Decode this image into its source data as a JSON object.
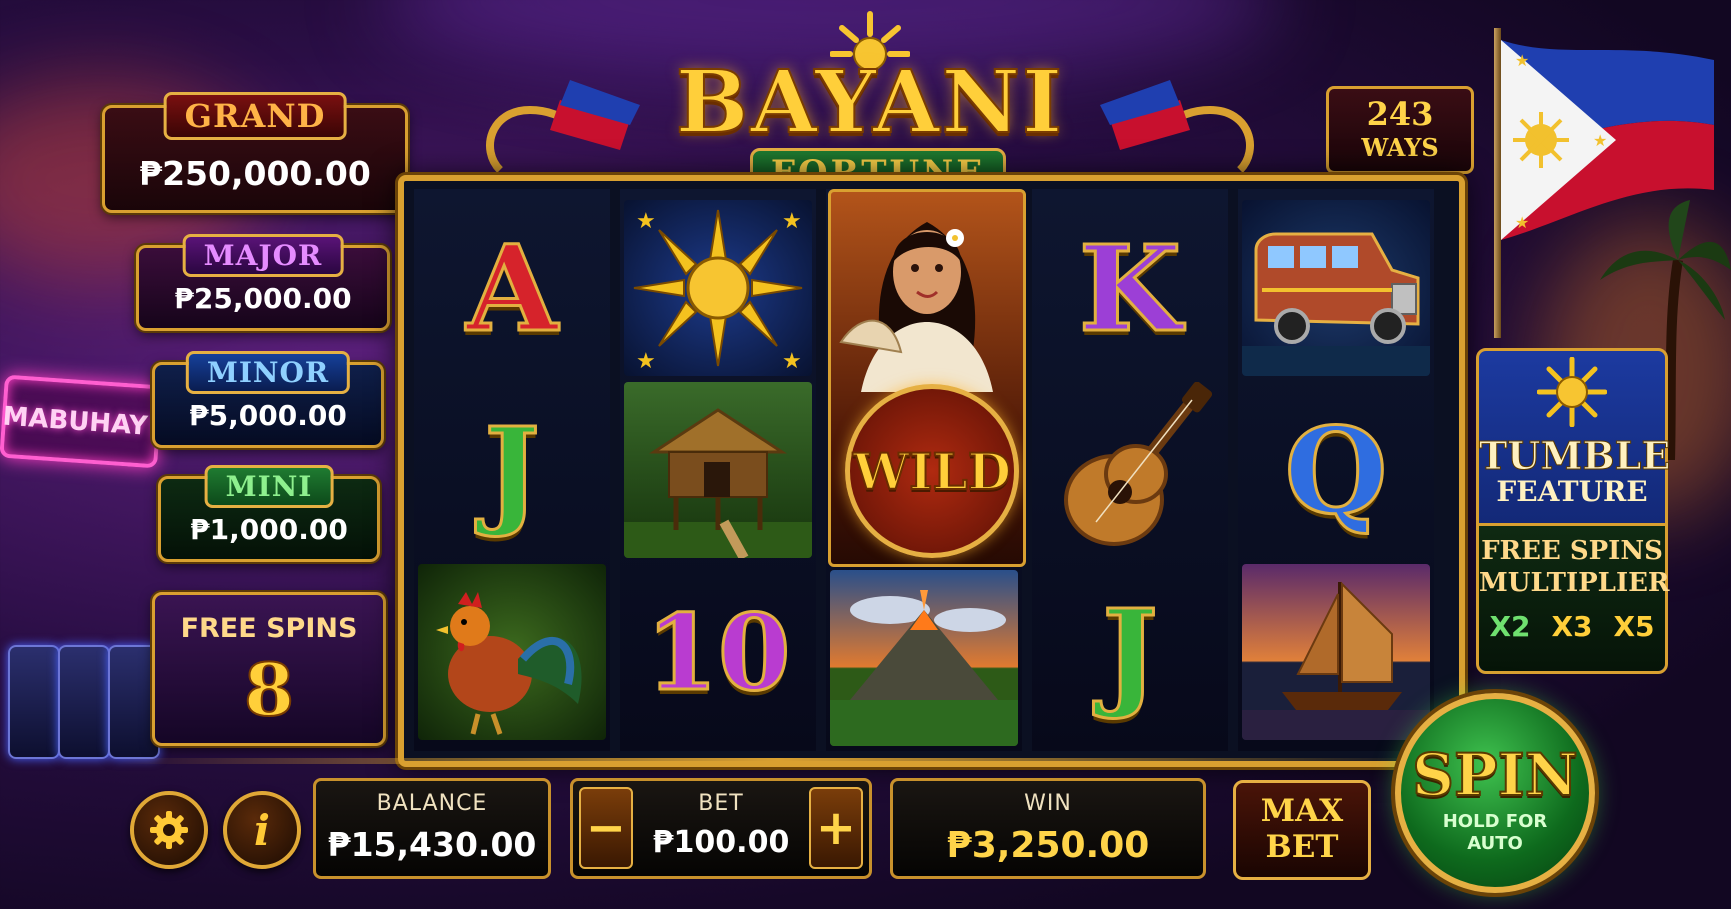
{
  "game": {
    "title_main": "BAYANI",
    "title_sub": "FORTUNE",
    "ways_number": "243",
    "ways_label": "WAYS",
    "neon_sign": "MABUHAY!"
  },
  "jackpots": [
    {
      "label": "GRAND",
      "value": "₱250,000.00",
      "color": "#ffb347"
    },
    {
      "label": "MAJOR",
      "value": "₱25,000.00",
      "color": "#e58cff"
    },
    {
      "label": "MINOR",
      "value": "₱5,000.00",
      "color": "#8fd0ff"
    },
    {
      "label": "MINI",
      "value": "₱1,000.00",
      "color": "#8ef08e"
    }
  ],
  "free_spins": {
    "label": "FREE SPINS",
    "count": "8"
  },
  "reels": [
    [
      "A",
      "J",
      "rooster-icon"
    ],
    [
      "sun-icon",
      "nipa-hut-icon",
      "10"
    ],
    [
      "filipina-icon",
      "WILD",
      "volcano-icon"
    ],
    [
      "K",
      "ukulele-icon",
      "J"
    ],
    [
      "jeepney-icon",
      "Q",
      "sailboat-icon"
    ]
  ],
  "symbols": {
    "a": "A",
    "j": "J",
    "ten": "10",
    "k": "K",
    "q": "Q",
    "wild": "WILD"
  },
  "feature_panel": {
    "title_line1": "TUMBLE",
    "title_line2": "FEATURE",
    "fs_line1": "FREE SPINS",
    "fs_line2": "MULTIPLIER",
    "multipliers": [
      "X2",
      "X3",
      "X5"
    ]
  },
  "controls": {
    "balance_label": "BALANCE",
    "balance_value": "₱15,430.00",
    "bet_label": "BET",
    "bet_value": "₱100.00",
    "bet_minus": "−",
    "bet_plus": "+",
    "win_label": "WIN",
    "win_value": "₱3,250.00",
    "max_bet_line1": "MAX",
    "max_bet_line2": "BET",
    "spin_label": "SPIN",
    "spin_hint_line1": "HOLD FOR",
    "spin_hint_line2": "AUTO",
    "settings_icon": "gear-icon",
    "info_icon": "info-icon",
    "info_glyph": "i"
  },
  "colors": {
    "gold": "#d9a030",
    "letter_red": "#d6232b",
    "letter_green": "#39b53a",
    "letter_purple": "#9c3fd6",
    "letter_blue": "#2f6de0",
    "letter_magenta": "#b93cd0"
  }
}
